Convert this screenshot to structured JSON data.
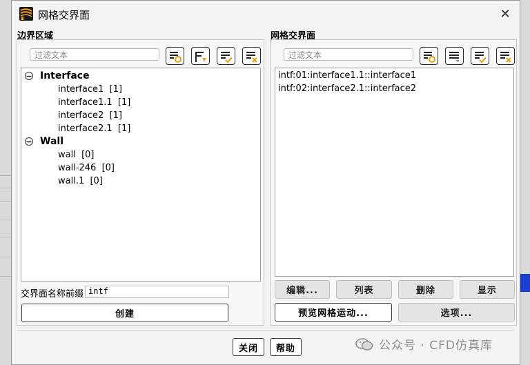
{
  "dialog": {
    "title": "网格交界面",
    "close_icon": "close-icon",
    "app_icon": "fluent-app-icon"
  },
  "left_panel": {
    "heading": "边界区域",
    "filter_placeholder": "过滤文本",
    "toolbar_icons": [
      "filter-options-icon",
      "select-from-file-icon",
      "select-all-icon",
      "deselect-all-icon"
    ],
    "tree": {
      "groups": [
        {
          "label": "Interface",
          "items": [
            "interface1  [1]",
            "interface1.1  [1]",
            "interface2  [1]",
            "interface2.1  [1]"
          ]
        },
        {
          "label": "Wall",
          "items": [
            "wall  [0]",
            "wall-246  [0]",
            "wall.1  [0]"
          ]
        }
      ]
    },
    "prefix_label": "交界面名称前缀",
    "prefix_value": "intf",
    "create_button": "创建"
  },
  "right_panel": {
    "heading": "网格交界面",
    "filter_placeholder": "过滤文本",
    "toolbar_icons": [
      "filter-options-icon",
      "sort-dropdown-icon",
      "select-all-icon",
      "deselect-all-icon"
    ],
    "items": [
      "intf:01:interface1.1::interface1",
      "intf:02:interface2.1::interface2"
    ],
    "buttons": {
      "edit": "编辑...",
      "list": "列表",
      "delete": "删除",
      "display": "显示",
      "preview_motion": "预览网格运动...",
      "options": "选项..."
    }
  },
  "footer": {
    "close_button": "关闭",
    "help_button": "帮助"
  },
  "watermark": {
    "text": "公众号 · CFD仿真库",
    "icon": "wechat-icon"
  },
  "colors": {
    "dialog_bg": "#f3f3f3",
    "listbox_bg": "#ffffff",
    "accent_orange": "#f0a020"
  }
}
